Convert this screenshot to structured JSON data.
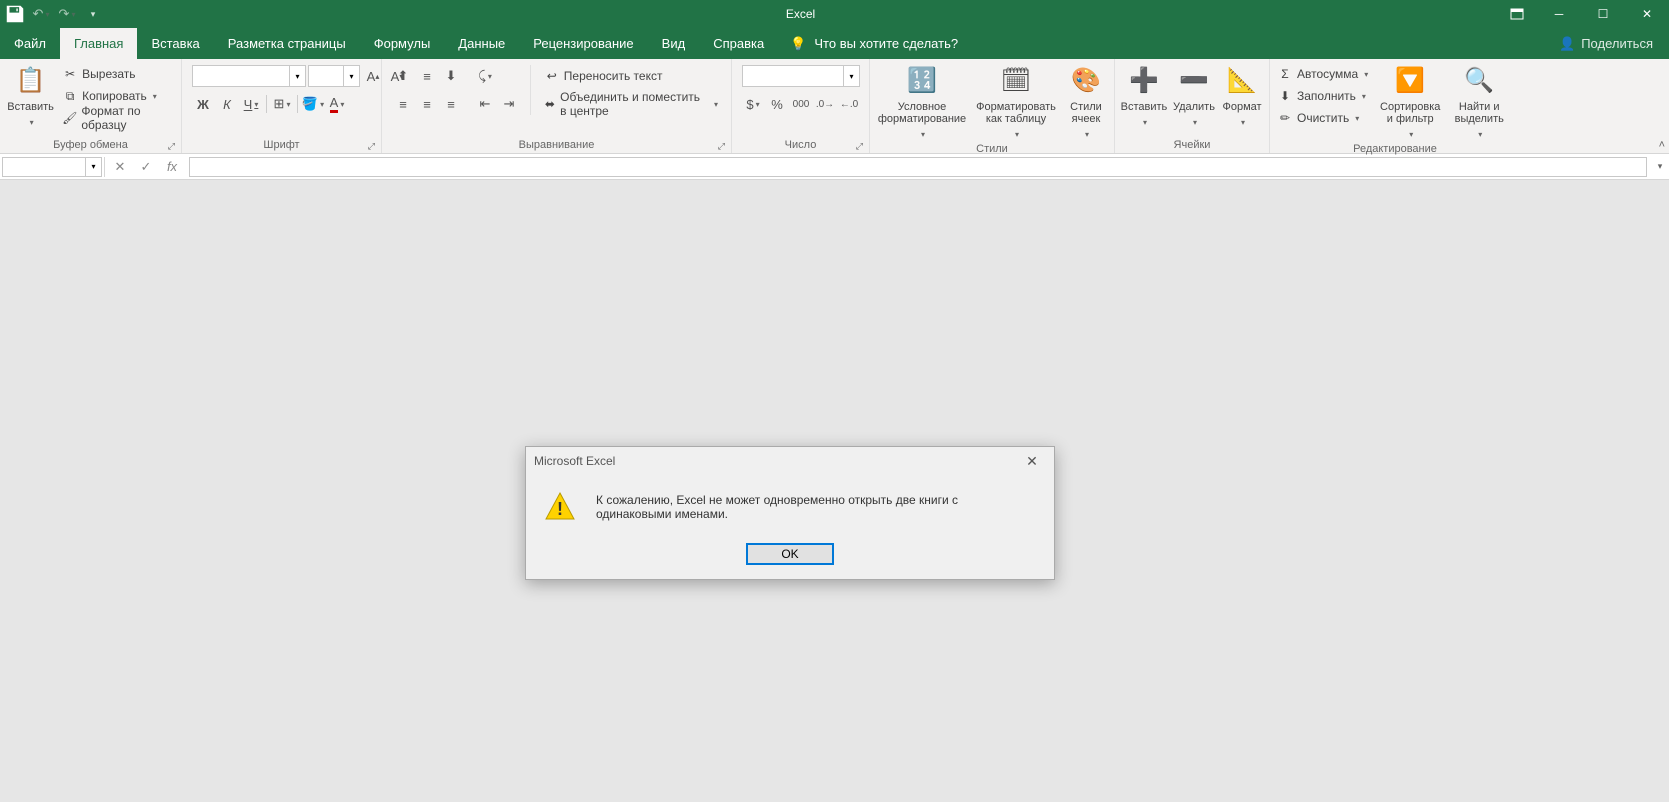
{
  "app": {
    "title": "Excel"
  },
  "titlebar": {
    "share": "Поделиться"
  },
  "tabs": {
    "file": "Файл",
    "home": "Главная",
    "insert": "Вставка",
    "page_layout": "Разметка страницы",
    "formulas": "Формулы",
    "data": "Данные",
    "review": "Рецензирование",
    "view": "Вид",
    "help": "Справка",
    "tell_me": "Что вы хотите сделать?"
  },
  "ribbon": {
    "clipboard": {
      "label": "Буфер обмена",
      "paste": "Вставить",
      "cut": "Вырезать",
      "copy": "Копировать",
      "format_painter": "Формат по образцу"
    },
    "font": {
      "label": "Шрифт"
    },
    "alignment": {
      "label": "Выравнивание",
      "wrap": "Переносить текст",
      "merge": "Объединить и поместить в центре"
    },
    "number": {
      "label": "Число"
    },
    "styles": {
      "label": "Стили",
      "conditional": "Условное форматирование",
      "as_table": "Форматировать как таблицу",
      "cell_styles": "Стили ячеек"
    },
    "cells": {
      "label": "Ячейки",
      "insert": "Вставить",
      "delete": "Удалить",
      "format": "Формат"
    },
    "editing": {
      "label": "Редактирование",
      "autosum": "Автосумма",
      "fill": "Заполнить",
      "clear": "Очистить",
      "sort": "Сортировка и фильтр",
      "find": "Найти и выделить"
    }
  },
  "dialog": {
    "title": "Microsoft Excel",
    "message": "К сожалению, Excel не может одновременно открыть две книги с одинаковыми именами.",
    "ok": "OK"
  }
}
